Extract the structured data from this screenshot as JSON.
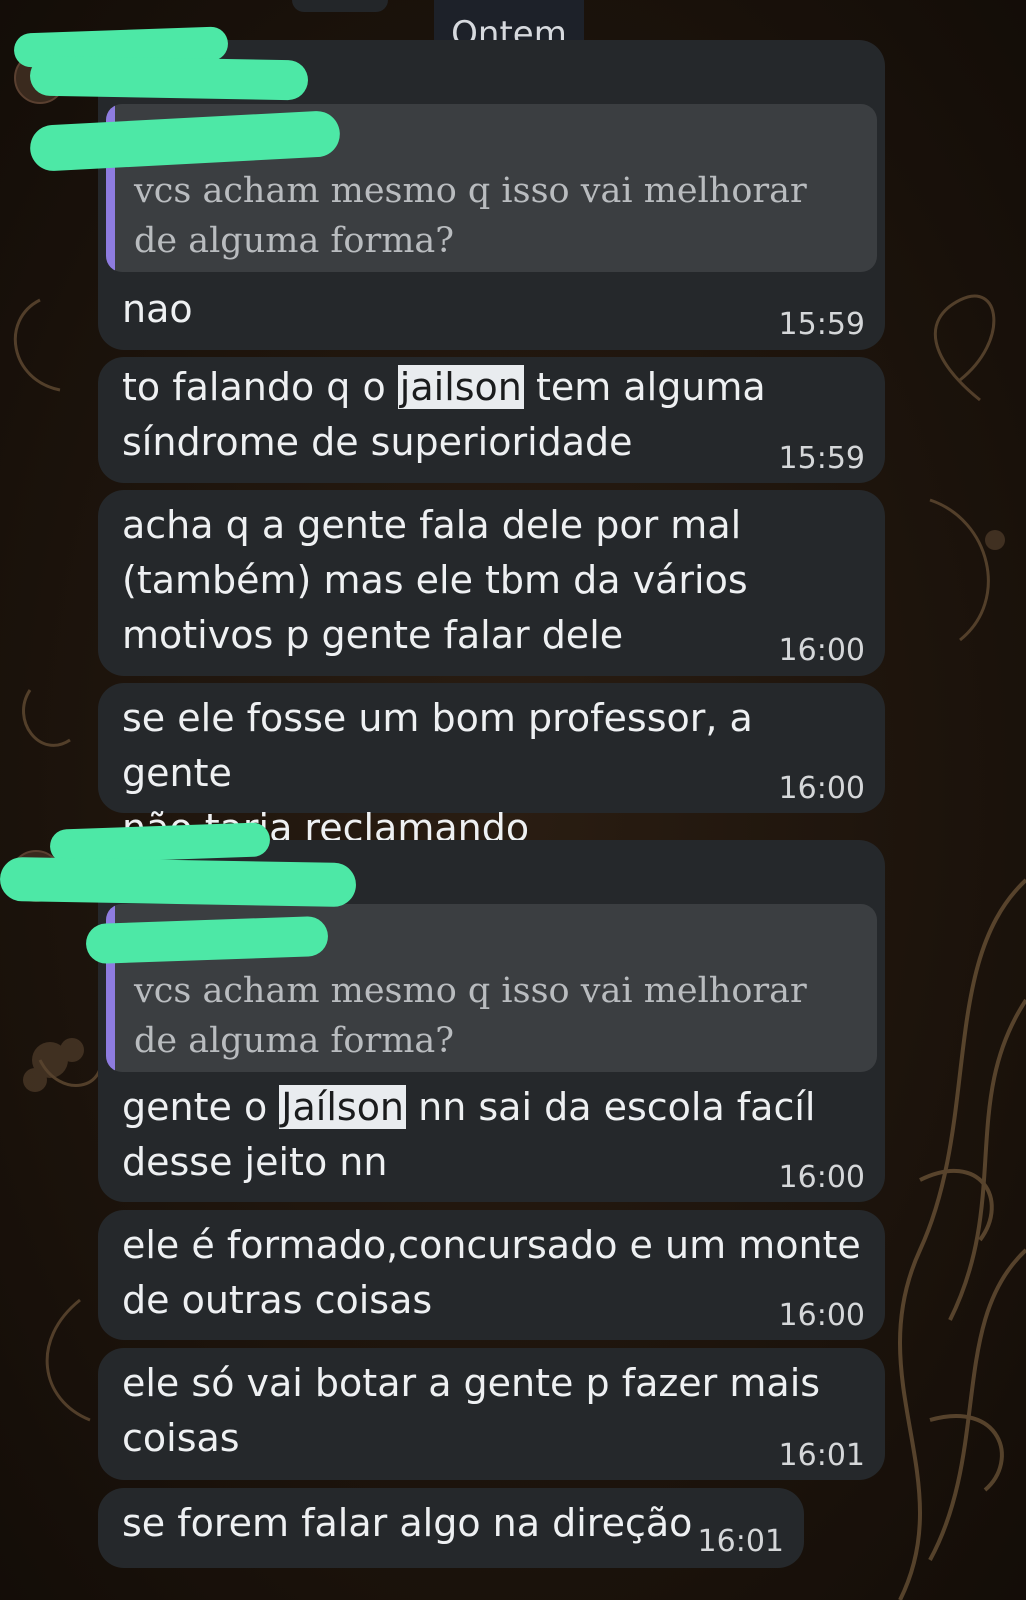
{
  "date_label": "Ontem",
  "groups": [
    {
      "reply_quote": "vcs acham mesmo q isso vai melhorar\nde alguma forma?",
      "messages": [
        {
          "text": "nao",
          "time": "15:59"
        },
        {
          "pre": "to falando q o ",
          "highlight": "jailson",
          "post": " tem alguma\nsíndrome de superioridade",
          "time": "15:59"
        },
        {
          "text": "acha q a gente fala dele por mal\n(também) mas ele tbm da vários\nmotivos p gente falar dele",
          "time": "16:00"
        },
        {
          "text": "se ele fosse um bom professor, a gente\nnão taria reclamando",
          "time": "16:00"
        }
      ]
    },
    {
      "reply_quote": "vcs acham mesmo q isso vai melhorar\nde alguma forma?",
      "messages": [
        {
          "pre": "gente o ",
          "highlight": "Jaílson",
          "post": " nn sai da escola facíl\ndesse jeito nn",
          "time": "16:00"
        },
        {
          "text": "ele é formado,concursado e um monte\nde outras coisas",
          "time": "16:00"
        },
        {
          "text": "ele só vai botar a gente p fazer mais\ncoisas",
          "time": "16:01"
        },
        {
          "text": "se forem falar algo na direção",
          "time": "16:01"
        }
      ]
    }
  ],
  "colors": {
    "bubble": "#25282b",
    "reply_bar": "#8e7ce0",
    "redaction": "#4de8a6"
  }
}
